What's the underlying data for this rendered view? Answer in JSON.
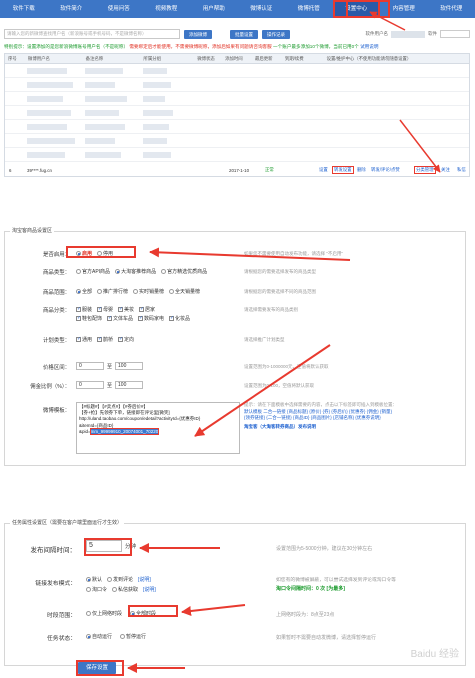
{
  "nav": {
    "items": [
      "软件下载",
      "软件简介",
      "使用问答",
      "视频教程",
      "用户帮助",
      "微博认证",
      "微博托管",
      "设置中心",
      "内容管理",
      "软件代理"
    ],
    "active": "设置中心"
  },
  "toolbar": {
    "search_placeholder": "请输入您的新微博查找用户名（新浪账号或手机号码，不是微博名称）",
    "add_button": "添加微博",
    "batch_button": "批量设置",
    "log_button": "操作记录",
    "acct_label": "软件用户名",
    "acct_suffix": "软件"
  },
  "notice": {
    "part1": "特别提示：设置添加的是您新浪微博账号用户名（不是昵称）",
    "part2": "需要绑定后才能使用，不需要微博昵称，添加后如果有问题请咨询客服",
    "part3": "一个账户最多添加10个微博，当前已用0个",
    "part4": "试用说明"
  },
  "table": {
    "headers": [
      "序号",
      "微博用户名",
      "备注名称",
      "所属分组",
      "微博状态",
      "添加时间",
      "最后更新",
      "到期/续费",
      "设置/维护中心（不使用功能请勿随意设置）"
    ],
    "last_row": {
      "index": "6",
      "name": "39****.fug.cn",
      "date": "2017-1-10",
      "status": "正常",
      "actions": [
        "设置",
        "转发设置",
        "删除",
        "转发/评论/点赞",
        "分类管理",
        "关注",
        "私信"
      ]
    }
  },
  "goods": {
    "section_title": "淘宝客商品设置区",
    "enable_label": "是否启用：",
    "enable_options": [
      "启用",
      "停用"
    ],
    "enable_hint": "如果您不需要使用自动发布功能，请选择 \"不启用\"",
    "type_label": "商品类型：",
    "type_options": [
      "官方API商品",
      "大淘客推荐商品",
      "官方精选优质商品"
    ],
    "type_hint": "请根据您的需要选择发布的商品类型",
    "range_label": "商品范围：",
    "range_options": [
      "全部",
      "推广排行榜",
      "实时销量榜",
      "全天销量榜"
    ],
    "range_hint": "请根据您的需要选择不同的商品范围",
    "cat_label": "商品分类：",
    "cat_options": [
      "服装",
      "母婴",
      "美妆",
      "居家",
      "鞋包配饰",
      "文体车品",
      "数码家电",
      "化妆品"
    ],
    "cat_hint": "请选择需要发布的商品类别",
    "plan_label": "计划类型：",
    "plan_options": [
      "通用",
      "鹊桥",
      "定向"
    ],
    "plan_hint": "请选择推广计划类型",
    "price_label": "价格区间：",
    "price_min": "0",
    "price_max": "100",
    "price_hint": "设置范围为0-1000000元，空值将默认获取",
    "rate_label": "佣金比例（%）：",
    "rate_min": "0",
    "rate_max": "100",
    "rate_hint": "设置范围为0-100，空值将默认获取",
    "tpl_label": "微博模板：",
    "tpl_lines": [
      "【#标题#】【#卖点#】【#券后价#】",
      "【券+抢】先领券下单，链接即在评论里[微笑]",
      "http://uland.taobao.com/coupon/edetail?activityId={优惠券ID}",
      "&itemId={商品ID}",
      "&pid=",
      "mm_99999910_20074001_70220"
    ],
    "var_title": "提示：请在下面模板中选择需要的内容，点击以下标签即可插入到模板位置：",
    "var_line1": "默认模板  二合一链接 {商品标题} {原价} {券} {券后价} {优惠券} {佣金} {销量}",
    "var_line2": "{领券链接} {二合一链接} {商品ID} {商品图片} {店铺名称} {优惠券说明}",
    "var_link": "淘宝客（大淘客转券商品）发布说明"
  },
  "task": {
    "section_title": "任务属性设置区（需要在客户端里面运行才生效）",
    "interval_label": "发布间隔时间：",
    "interval_value": "5",
    "interval_unit": "分钟",
    "interval_hint": "设置范围为5-5000分钟，建议在30分钟左右",
    "link_label": "链接发布模式：",
    "link_options": [
      "默认",
      "发到评论",
      "淘口令",
      "私信获取"
    ],
    "link_note": "[说明]",
    "link_hint": "如您有的微博被屏蔽，可以尝试选择发到评论或淘口令等",
    "link_extra": "淘口令间隔时间：0 次 [为最多]",
    "time_label": "时段范围：",
    "time_options": [
      "仅上网络时段",
      "全部时段"
    ],
    "time_hint": "上网络时段为：8点至23点",
    "status_label": "任务状态：",
    "status_options": [
      "自动运行",
      "暂停运行"
    ],
    "status_hint": "如果暂时不需要自动发微博，请选择暂停运行",
    "save_button": "保存设置"
  },
  "watermark": "Baidu 经验"
}
